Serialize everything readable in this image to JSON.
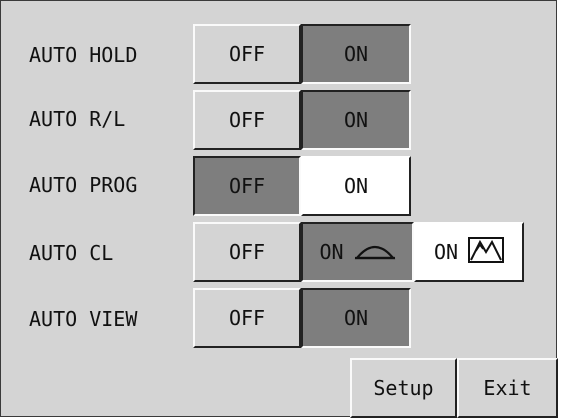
{
  "rows": [
    {
      "label": "AUTO HOLD",
      "off": "OFF",
      "on": "ON",
      "selected": "on"
    },
    {
      "label": "AUTO R/L",
      "off": "OFF",
      "on": "ON",
      "selected": "on"
    },
    {
      "label": "AUTO PROG",
      "off": "OFF",
      "on": "ON",
      "selected": "off"
    },
    {
      "label": "AUTO CL",
      "off": "OFF",
      "on": "ON",
      "on_alt": "ON",
      "selected": "on",
      "icons": [
        "dome-lens-icon",
        "mountain-lens-icon"
      ]
    },
    {
      "label": "AUTO VIEW",
      "off": "OFF",
      "on": "ON",
      "selected": "on"
    }
  ],
  "footer": {
    "setup_label": "Setup",
    "exit_label": "Exit"
  },
  "colors": {
    "panel": "#d4d4d4",
    "active": "#7e7e7e",
    "highlight": "#ffffff",
    "shadow": "#222222"
  }
}
